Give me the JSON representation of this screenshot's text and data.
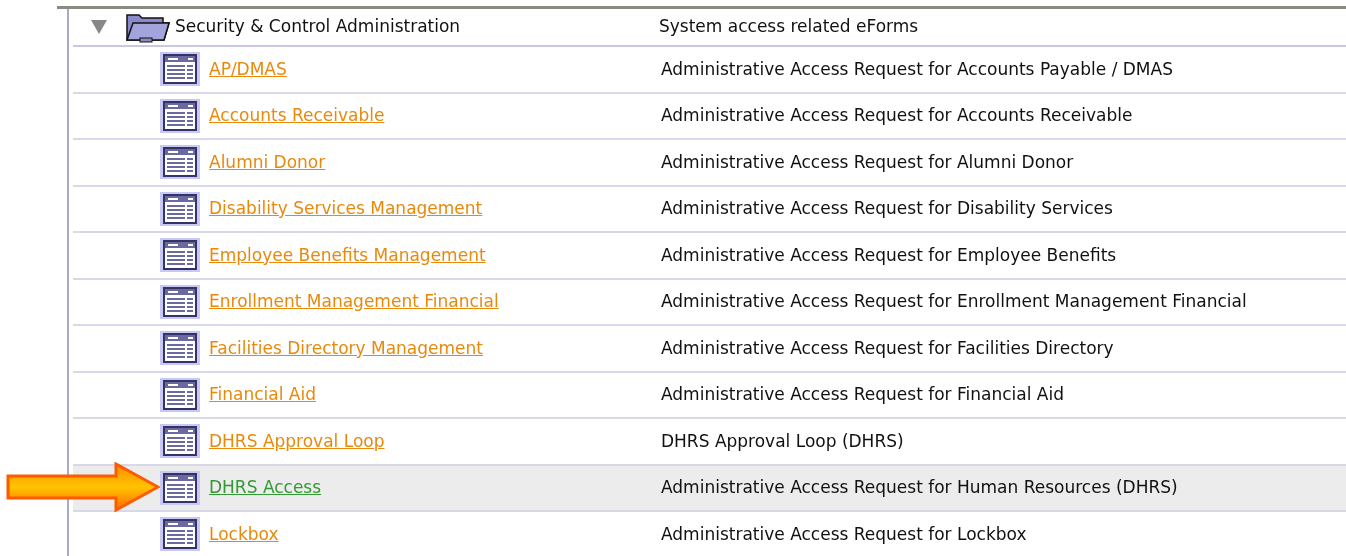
{
  "folder": {
    "name": "Security & Control Administration",
    "description": "System access related eForms",
    "expanded": true
  },
  "items": [
    {
      "name": "AP/DMAS",
      "description": "Administrative Access Request for Accounts Payable / DMAS",
      "selected": false
    },
    {
      "name": "Accounts Receivable",
      "description": "Administrative Access Request for Accounts Receivable",
      "selected": false
    },
    {
      "name": "Alumni Donor",
      "description": "Administrative Access Request for Alumni Donor",
      "selected": false
    },
    {
      "name": "Disability Services Management",
      "description": "Administrative Access Request for Disability Services",
      "selected": false
    },
    {
      "name": "Employee Benefits Management",
      "description": "Administrative Access Request for Employee Benefits",
      "selected": false
    },
    {
      "name": "Enrollment Management Financial",
      "description": "Administrative Access Request for Enrollment Management Financial",
      "selected": false
    },
    {
      "name": "Facilities Directory Management",
      "description": "Administrative Access Request for Facilities Directory",
      "selected": false
    },
    {
      "name": "Financial Aid",
      "description": "Administrative Access Request for Financial Aid",
      "selected": false
    },
    {
      "name": "DHRS Approval Loop",
      "description": "DHRS Approval Loop (DHRS)",
      "selected": false
    },
    {
      "name": "DHRS Access",
      "description": "Administrative Access Request for Human Resources (DHRS)",
      "selected": true
    },
    {
      "name": "Lockbox",
      "description": "Administrative Access Request for Lockbox",
      "selected": false
    }
  ]
}
